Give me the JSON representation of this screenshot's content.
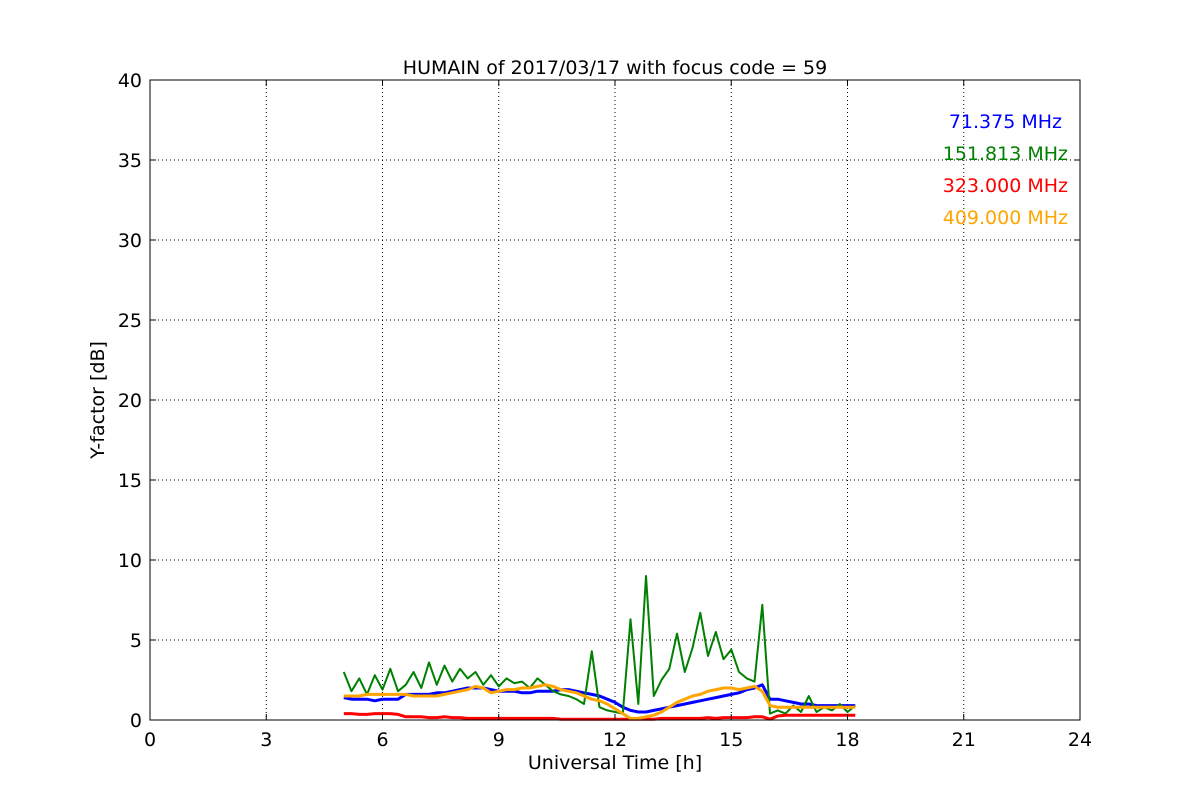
{
  "chart_data": {
    "type": "line",
    "title": "HUMAIN of 2017/03/17 with focus code = 59",
    "xlabel": "Universal Time [h]",
    "ylabel": "Y-factor [dB]",
    "xlim": [
      0,
      24
    ],
    "ylim": [
      0,
      40
    ],
    "xticks": [
      "0",
      "3",
      "6",
      "9",
      "12",
      "15",
      "18",
      "21",
      "24"
    ],
    "yticks": [
      "0",
      "5",
      "10",
      "15",
      "20",
      "25",
      "30",
      "35",
      "40"
    ],
    "grid": true,
    "legend_placement": "top-right",
    "x": [
      5.0,
      5.2,
      5.4,
      5.6,
      5.8,
      6.0,
      6.2,
      6.4,
      6.6,
      6.8,
      7.0,
      7.2,
      7.4,
      7.6,
      7.8,
      8.0,
      8.2,
      8.4,
      8.6,
      8.8,
      9.0,
      9.2,
      9.4,
      9.6,
      9.8,
      10.0,
      10.2,
      10.4,
      10.6,
      10.8,
      11.0,
      11.2,
      11.4,
      11.6,
      11.8,
      12.0,
      12.2,
      12.4,
      12.6,
      12.8,
      13.0,
      13.2,
      13.4,
      13.6,
      13.8,
      14.0,
      14.2,
      14.4,
      14.6,
      14.8,
      15.0,
      15.2,
      15.4,
      15.6,
      15.8,
      16.0,
      16.2,
      16.4,
      16.6,
      16.8,
      17.0,
      17.2,
      17.4,
      17.6,
      17.8,
      18.0,
      18.2
    ],
    "series": [
      {
        "name": "71.375 MHz",
        "color": "#0000ff",
        "values": [
          1.4,
          1.3,
          1.3,
          1.3,
          1.2,
          1.3,
          1.3,
          1.3,
          1.6,
          1.6,
          1.6,
          1.6,
          1.7,
          1.7,
          1.8,
          1.9,
          2.0,
          2.0,
          2.0,
          1.9,
          1.8,
          1.8,
          1.8,
          1.7,
          1.7,
          1.8,
          1.8,
          1.8,
          1.9,
          1.9,
          1.8,
          1.7,
          1.6,
          1.5,
          1.3,
          1.1,
          0.8,
          0.6,
          0.5,
          0.5,
          0.6,
          0.7,
          0.8,
          0.9,
          1.0,
          1.1,
          1.2,
          1.3,
          1.4,
          1.5,
          1.6,
          1.7,
          1.9,
          2.0,
          2.2,
          1.3,
          1.3,
          1.2,
          1.1,
          1.0,
          1.0,
          0.9,
          0.9,
          0.9,
          0.9,
          0.9,
          0.9
        ]
      },
      {
        "name": "151.813 MHz",
        "color": "#008000",
        "values": [
          3.0,
          1.8,
          2.6,
          1.6,
          2.8,
          1.9,
          3.2,
          1.8,
          2.2,
          3.0,
          2.0,
          3.6,
          2.2,
          3.4,
          2.4,
          3.2,
          2.6,
          3.0,
          2.2,
          2.8,
          2.1,
          2.6,
          2.3,
          2.4,
          2.0,
          2.6,
          2.2,
          1.8,
          1.6,
          1.5,
          1.3,
          1.0,
          4.3,
          0.8,
          0.6,
          0.5,
          0.4,
          6.3,
          1.0,
          9.0,
          1.5,
          2.5,
          3.2,
          5.4,
          3.0,
          4.5,
          6.7,
          4.0,
          5.5,
          3.8,
          4.4,
          3.0,
          2.6,
          2.4,
          7.2,
          0.4,
          0.6,
          0.4,
          0.9,
          0.5,
          1.5,
          0.5,
          0.8,
          0.6,
          1.0,
          0.5,
          0.9
        ]
      },
      {
        "name": "323.000 MHz",
        "color": "#ff0000",
        "values": [
          0.4,
          0.4,
          0.35,
          0.35,
          0.4,
          0.4,
          0.4,
          0.35,
          0.2,
          0.2,
          0.2,
          0.15,
          0.15,
          0.2,
          0.15,
          0.15,
          0.1,
          0.1,
          0.1,
          0.1,
          0.1,
          0.1,
          0.1,
          0.1,
          0.1,
          0.1,
          0.1,
          0.1,
          0.05,
          0.05,
          0.05,
          0.05,
          0.05,
          0.05,
          0.05,
          0.05,
          0.05,
          0.05,
          0.05,
          0.05,
          0.05,
          0.1,
          0.1,
          0.1,
          0.1,
          0.1,
          0.1,
          0.15,
          0.1,
          0.15,
          0.15,
          0.15,
          0.15,
          0.2,
          0.2,
          0.05,
          0.25,
          0.3,
          0.3,
          0.3,
          0.3,
          0.3,
          0.3,
          0.3,
          0.3,
          0.3,
          0.3
        ]
      },
      {
        "name": "409.000 MHz",
        "color": "#ffa500",
        "values": [
          1.5,
          1.5,
          1.5,
          1.6,
          1.6,
          1.6,
          1.6,
          1.6,
          1.6,
          1.5,
          1.5,
          1.5,
          1.5,
          1.6,
          1.7,
          1.8,
          1.9,
          2.1,
          2.0,
          1.7,
          1.8,
          1.9,
          1.9,
          2.0,
          2.0,
          2.1,
          2.2,
          2.1,
          1.9,
          1.8,
          1.7,
          1.5,
          1.3,
          1.2,
          1.0,
          0.7,
          0.4,
          0.1,
          0.1,
          0.2,
          0.3,
          0.5,
          0.8,
          1.1,
          1.3,
          1.5,
          1.6,
          1.8,
          1.9,
          2.0,
          2.0,
          1.9,
          2.0,
          2.1,
          1.8,
          0.9,
          0.8,
          0.8,
          0.8,
          0.8,
          0.8,
          0.8,
          0.8,
          0.8,
          0.8,
          0.8,
          0.8
        ]
      }
    ]
  }
}
